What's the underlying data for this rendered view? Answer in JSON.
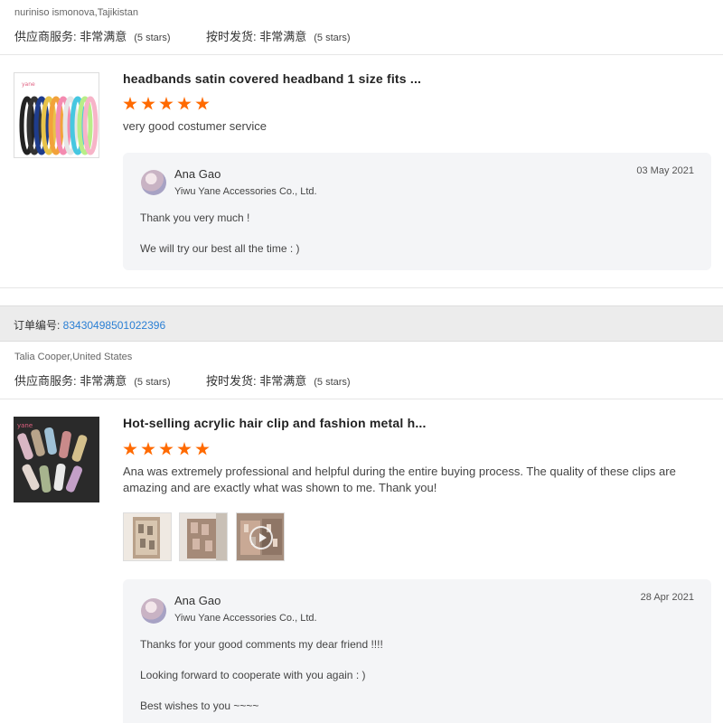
{
  "reviews": [
    {
      "buyer": "nuriniso ismonova,Tajikistan",
      "service_label": "供应商服务: ",
      "service_value": "非常满意",
      "service_stars": "(5 stars)",
      "ship_label": "按时发货: ",
      "ship_value": "非常满意",
      "ship_stars": "(5 stars)",
      "product_title": "headbands satin covered headband 1 size fits ...",
      "rating": 5,
      "text": "very good costumer service",
      "reply": {
        "name": "Ana Gao",
        "company": "Yiwu Yane Accessories Co., Ltd.",
        "date": "03 May 2021",
        "lines": [
          "Thank you very much !",
          "We will try our best all the time : )"
        ]
      }
    },
    {
      "order_label": "订单编号: ",
      "order_number": "83430498501022396",
      "buyer": "Talia Cooper,United States",
      "service_label": "供应商服务: ",
      "service_value": "非常满意",
      "service_stars": "(5 stars)",
      "ship_label": "按时发货: ",
      "ship_value": "非常满意",
      "ship_stars": "(5 stars)",
      "product_title": "Hot-selling acrylic hair clip and fashion metal h...",
      "rating": 5,
      "text_line1": "Ana was extremely professional and helpful during the entire buying process. The quality of these clips are",
      "text_line2": "amazing and are exactly what was shown to me. Thank you!",
      "photos": [
        "review-photo-1",
        "review-photo-2",
        "review-video-thumb"
      ],
      "reply": {
        "name": "Ana Gao",
        "company": "Yiwu Yane Accessories Co., Ltd.",
        "date": "28 Apr 2021",
        "lines": [
          "Thanks for your good comments my dear friend !!!!",
          "Looking forward to cooperate with you again : )",
          "Best wishes to you ~~~~"
        ]
      }
    }
  ],
  "colors": {
    "star": "#ff6a00",
    "link": "#2a7fd4",
    "reply_bg": "#f4f5f7",
    "order_bar_bg": "#ececec"
  }
}
